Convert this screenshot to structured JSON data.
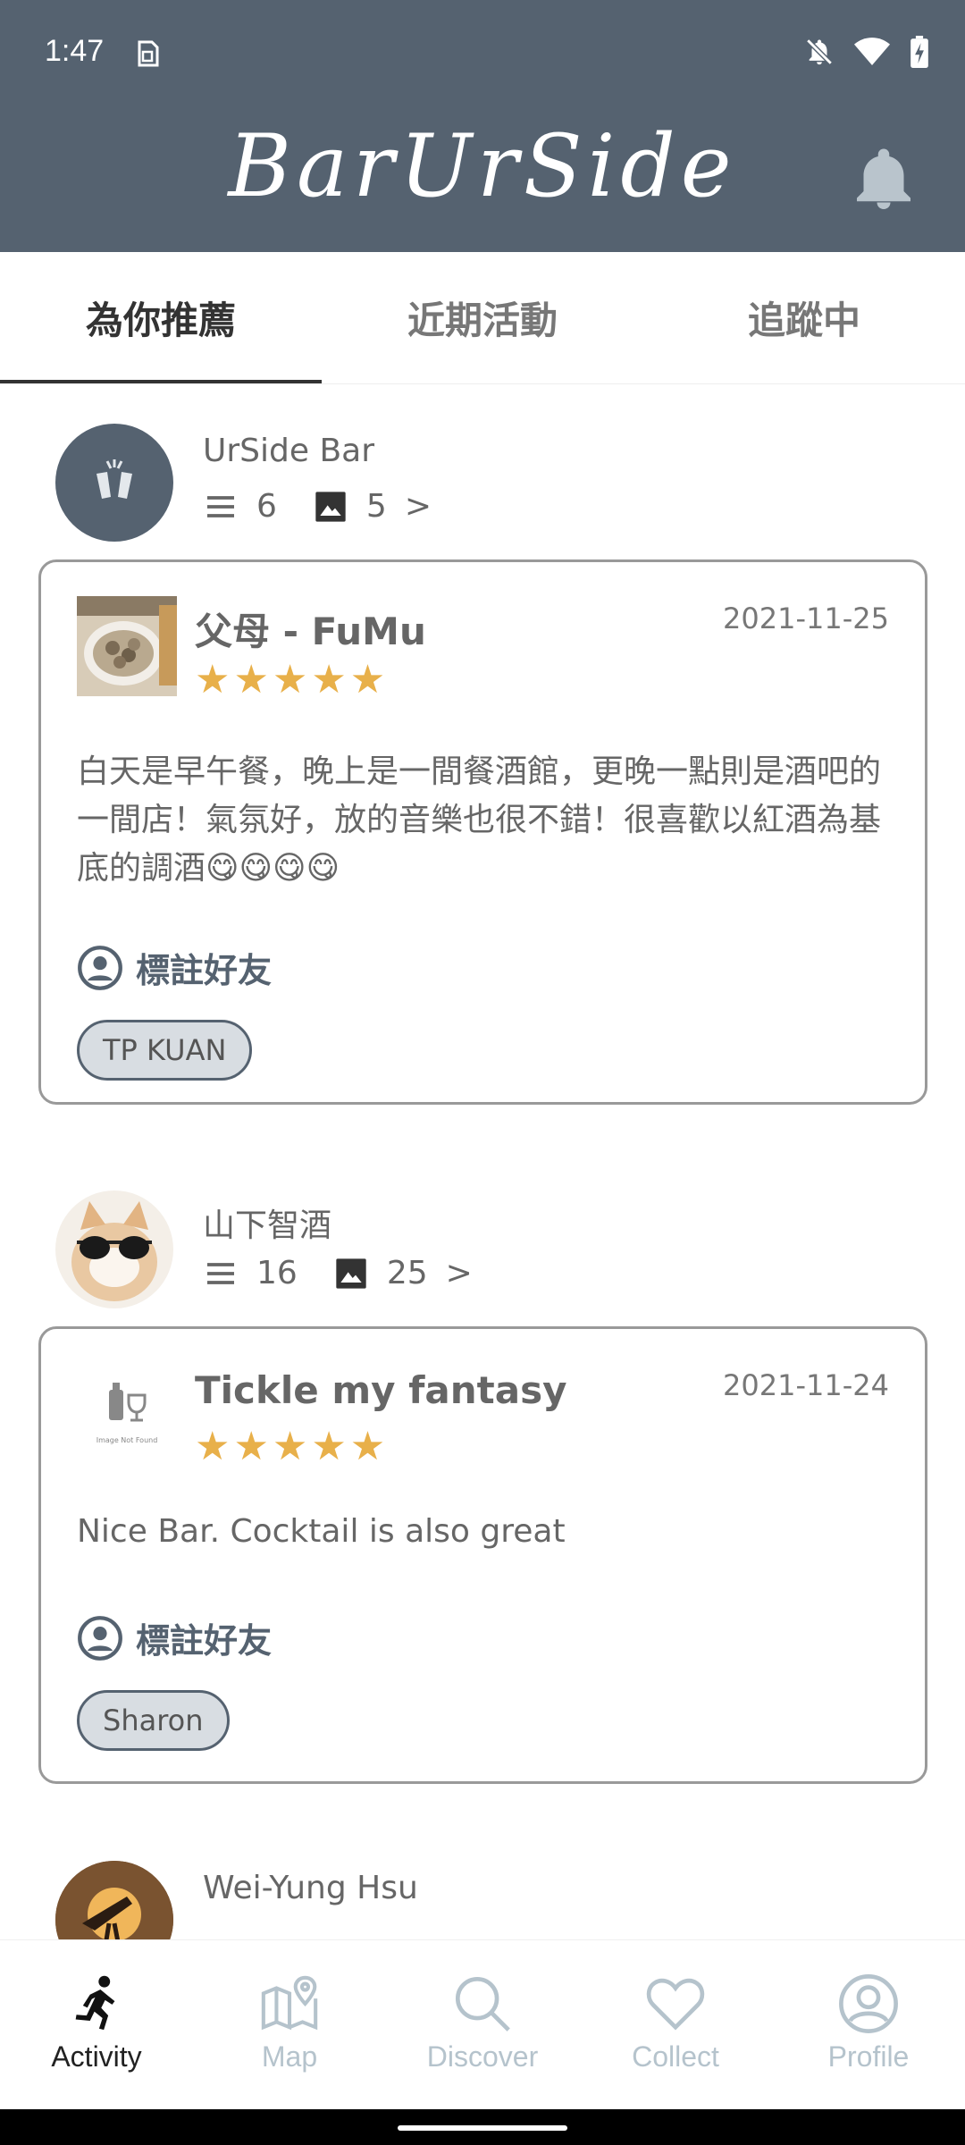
{
  "status_bar": {
    "time": "1:47"
  },
  "header": {
    "brand": "BarUrSide"
  },
  "tabs": [
    {
      "label": "為你推薦",
      "active": true
    },
    {
      "label": "近期活動",
      "active": false
    },
    {
      "label": "追蹤中",
      "active": false
    }
  ],
  "feed": [
    {
      "user": "UrSide Bar",
      "list_count": "6",
      "photo_count": "5",
      "more": ">",
      "card": {
        "title": "父母 - FuMu",
        "date": "2021-11-25",
        "stars": "★★★★★",
        "text": "白天是早午餐，晚上是一間餐酒館，更晚一點則是酒吧的一間店！氣氛好，放的音樂也很不錯！很喜歡以紅酒為基底的調酒😋😋😋😋",
        "tag_label": "標註好友",
        "tag": "TP KUAN"
      }
    },
    {
      "user": "山下智酒",
      "list_count": "16",
      "photo_count": "25",
      "more": ">",
      "card": {
        "title": "Tickle my fantasy",
        "date": "2021-11-24",
        "stars": "★★★★★",
        "text": "Nice Bar. Cocktail is also great",
        "tag_label": "標註好友",
        "tag": "Sharon",
        "thumb_caption": "Image Not Found"
      }
    },
    {
      "user": "Wei-Yung Hsu"
    }
  ],
  "bottom_nav": [
    {
      "label": "Activity",
      "icon": "running-person-icon",
      "active": true
    },
    {
      "label": "Map",
      "icon": "map-pin-icon",
      "active": false
    },
    {
      "label": "Discover",
      "icon": "search-icon",
      "active": false
    },
    {
      "label": "Collect",
      "icon": "heart-icon",
      "active": false
    },
    {
      "label": "Profile",
      "icon": "profile-icon",
      "active": false
    }
  ],
  "colors": {
    "header_bg": "#556270",
    "star": "#e8b04a",
    "nav_inactive": "#b5c3cc"
  }
}
